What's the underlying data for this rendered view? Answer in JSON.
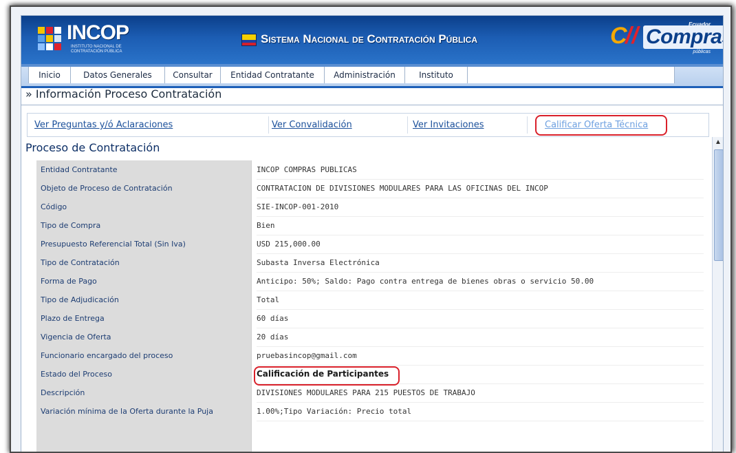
{
  "header": {
    "logo_left_text": "INCOP",
    "logo_left_subtitle": "Instituto Nacional de Contratación Pública",
    "title": "Sistema Nacional de Contratación Pública",
    "logo_right_text": "Compras",
    "logo_right_top": "Ecuador",
    "logo_right_bottom": "públicas"
  },
  "nav": {
    "items": [
      "Inicio",
      "Datos Generales",
      "Consultar",
      "Entidad Contratante",
      "Administración",
      "Instituto"
    ]
  },
  "page": {
    "title": "» Información Proceso Contratación"
  },
  "links": {
    "preguntas": "Ver Preguntas y/ó Aclaraciones",
    "convalidacion": "Ver Convalidación",
    "invitaciones": "Ver Invitaciones",
    "calificar": "Calificar Oferta Técnica"
  },
  "section": {
    "title": "Proceso de Contratación"
  },
  "details": [
    {
      "label": "Entidad Contratante",
      "value": "INCOP COMPRAS PUBLICAS"
    },
    {
      "label": "Objeto de Proceso de Contratación",
      "value": "CONTRATACION DE DIVISIONES MODULARES PARA LAS OFICINAS DEL INCOP"
    },
    {
      "label": "Código",
      "value": "SIE-INCOP-001-2010"
    },
    {
      "label": "Tipo de Compra",
      "value": "Bien"
    },
    {
      "label": "Presupuesto Referencial Total (Sin Iva)",
      "value": "USD 215,000.00"
    },
    {
      "label": "Tipo de Contratación",
      "value": "Subasta Inversa Electrónica"
    },
    {
      "label": "Forma de Pago",
      "value": "Anticipo: 50%; Saldo: Pago contra entrega de bienes obras o servicio 50.00"
    },
    {
      "label": "Tipo de Adjudicación",
      "value": "Total"
    },
    {
      "label": "Plazo de Entrega",
      "value": "60 días"
    },
    {
      "label": "Vigencia de Oferta",
      "value": "20 días"
    },
    {
      "label": "Funcionario encargado del proceso",
      "value": "pruebasincop@gmail.com"
    },
    {
      "label": "Estado del Proceso",
      "value": "Calificación de Participantes"
    },
    {
      "label": "Descripción",
      "value": "DIVISIONES MODULARES PARA 215 PUESTOS DE TRABAJO"
    },
    {
      "label": "Variación mínima de la Oferta durante la Puja",
      "value": "1.00%;Tipo Variación: Precio total"
    }
  ],
  "colors": {
    "banner": "#1c5db3",
    "label_bg": "#dcdcdc",
    "highlight": "#d9202a",
    "link": "#1a4f9a"
  }
}
